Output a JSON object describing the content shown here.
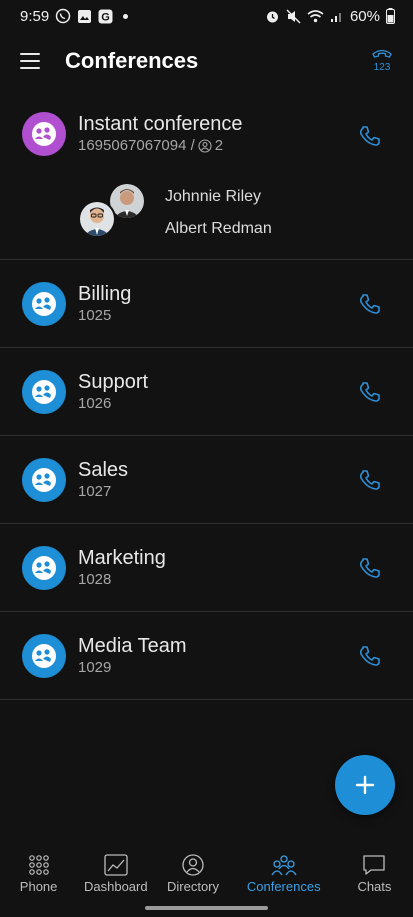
{
  "status_bar": {
    "time": "9:59",
    "battery": "60%",
    "left_icons": [
      "whatsapp-icon",
      "gallery-icon",
      "g-app-icon",
      "notification-dot"
    ],
    "right_icons": [
      "alarm-icon",
      "mute-icon",
      "wifi-icon",
      "signal-icon",
      "battery-icon"
    ]
  },
  "app_bar": {
    "title": "Conferences",
    "dialpad_label": "123"
  },
  "colors": {
    "accent": "#1e8fd6",
    "instant_avatar": "#b04fd0",
    "background": "#121212",
    "active_nav": "#3aa0e6"
  },
  "conferences": [
    {
      "name": "Instant conference",
      "number": "1695067067094 /",
      "participant_count": "2",
      "participants": [
        "Johnnie Riley",
        "Albert Redman"
      ]
    },
    {
      "name": "Billing",
      "number": "1025"
    },
    {
      "name": "Support",
      "number": "1026"
    },
    {
      "name": "Sales",
      "number": "1027"
    },
    {
      "name": "Marketing",
      "number": "1028"
    },
    {
      "name": "Media Team",
      "number": "1029"
    }
  ],
  "fab": {
    "icon": "plus-icon"
  },
  "bottom_nav": [
    {
      "label": "Phone",
      "icon": "dialpad-grid-icon",
      "active": false
    },
    {
      "label": "Dashboard",
      "icon": "chart-icon",
      "active": false
    },
    {
      "label": "Directory",
      "icon": "contact-icon",
      "active": false
    },
    {
      "label": "Conferences",
      "icon": "group-icon",
      "active": true
    },
    {
      "label": "Chats",
      "icon": "chat-bubble-icon",
      "active": false
    }
  ]
}
